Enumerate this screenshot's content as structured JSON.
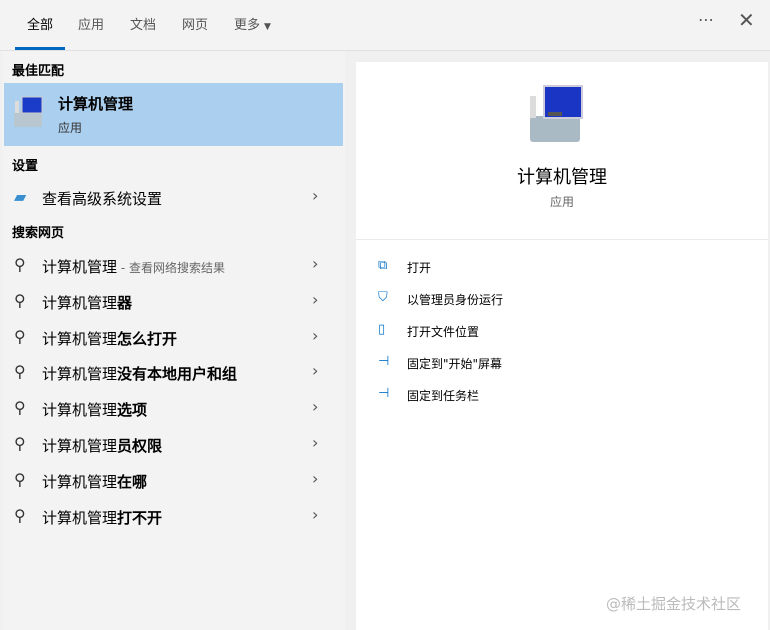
{
  "tabs": [
    "全部",
    "应用",
    "文档",
    "网页",
    "更多"
  ],
  "more_icon": "⋯",
  "close_icon": "✕",
  "best_match": {
    "header": "最佳匹配",
    "title": "计算机管理",
    "subtitle": "应用"
  },
  "settings": {
    "header": "设置",
    "items": [
      {
        "label": "查看高级系统设置"
      }
    ]
  },
  "web": {
    "header": "搜索网页",
    "items": [
      {
        "prefix": "计算机管理",
        "bold": "",
        "hint": " - 查看网络搜索结果"
      },
      {
        "prefix": "计算机管理",
        "bold": "器",
        "hint": ""
      },
      {
        "prefix": "计算机管理",
        "bold": "怎么打开",
        "hint": ""
      },
      {
        "prefix": "计算机管理",
        "bold": "没有本地用户和组",
        "hint": ""
      },
      {
        "prefix": "计算机管理",
        "bold": "选项",
        "hint": ""
      },
      {
        "prefix": "计算机管理",
        "bold": "员权限",
        "hint": ""
      },
      {
        "prefix": "计算机管理",
        "bold": "在哪",
        "hint": ""
      },
      {
        "prefix": "计算机管理",
        "bold": "打不开",
        "hint": ""
      }
    ]
  },
  "detail": {
    "title": "计算机管理",
    "subtitle": "应用",
    "actions": [
      {
        "label": "打开",
        "icon": "open-icon"
      },
      {
        "label": "以管理员身份运行",
        "icon": "shield-icon"
      },
      {
        "label": "打开文件位置",
        "icon": "folder-icon"
      },
      {
        "label": "固定到\"开始\"屏幕",
        "icon": "pin-icon"
      },
      {
        "label": "固定到任务栏",
        "icon": "pin-icon"
      }
    ]
  },
  "watermark": "@稀土掘金技术社区",
  "colors": {
    "accent": "#0067c0",
    "selected": "#abcfee"
  }
}
